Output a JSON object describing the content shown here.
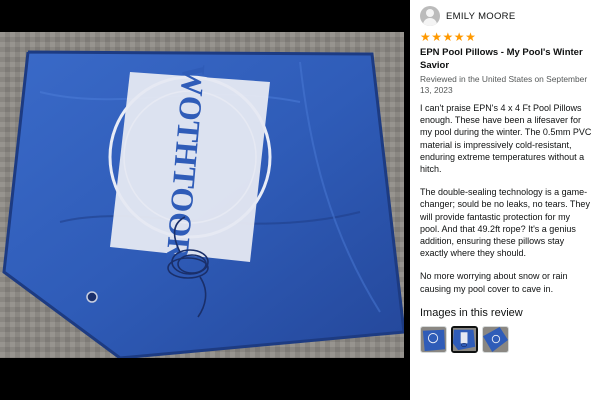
{
  "reviewer": {
    "name": "EMILY MOORE",
    "avatar_icon": "user-avatar-icon"
  },
  "rating": {
    "stars": 5,
    "max": 5,
    "color": "#ff9900"
  },
  "review": {
    "title": "EPN Pool Pillows - My Pool's Winter Savior",
    "meta": "Reviewed in the United States on September 13, 2023",
    "paragraphs": [
      "I can't praise EPN's 4 x 4 Ft Pool Pillows enough. These have been a lifesaver for my pool during the winter. The 0.5mm PVC material is impressively cold-resistant, enduring extreme temperatures without a hitch.",
      "The double-sealing technology is a game-changer; sould be no leaks, no tears. They will provide fantastic protection for my pool. And that 49.2ft rope? It's a genius addition, ensuring these pillows stay exactly where they should.",
      "No more worrying about snow or rain causing my pool cover to cave in."
    ]
  },
  "images": {
    "heading": "Images in this review",
    "thumbnails": [
      {
        "label": "review-image-1",
        "selected": false
      },
      {
        "label": "review-image-2",
        "selected": true
      },
      {
        "label": "review-image-3",
        "selected": false
      }
    ]
  },
  "photo": {
    "pillow_color": "#2f5cb8",
    "logo_text": "WOTHTOOR"
  }
}
